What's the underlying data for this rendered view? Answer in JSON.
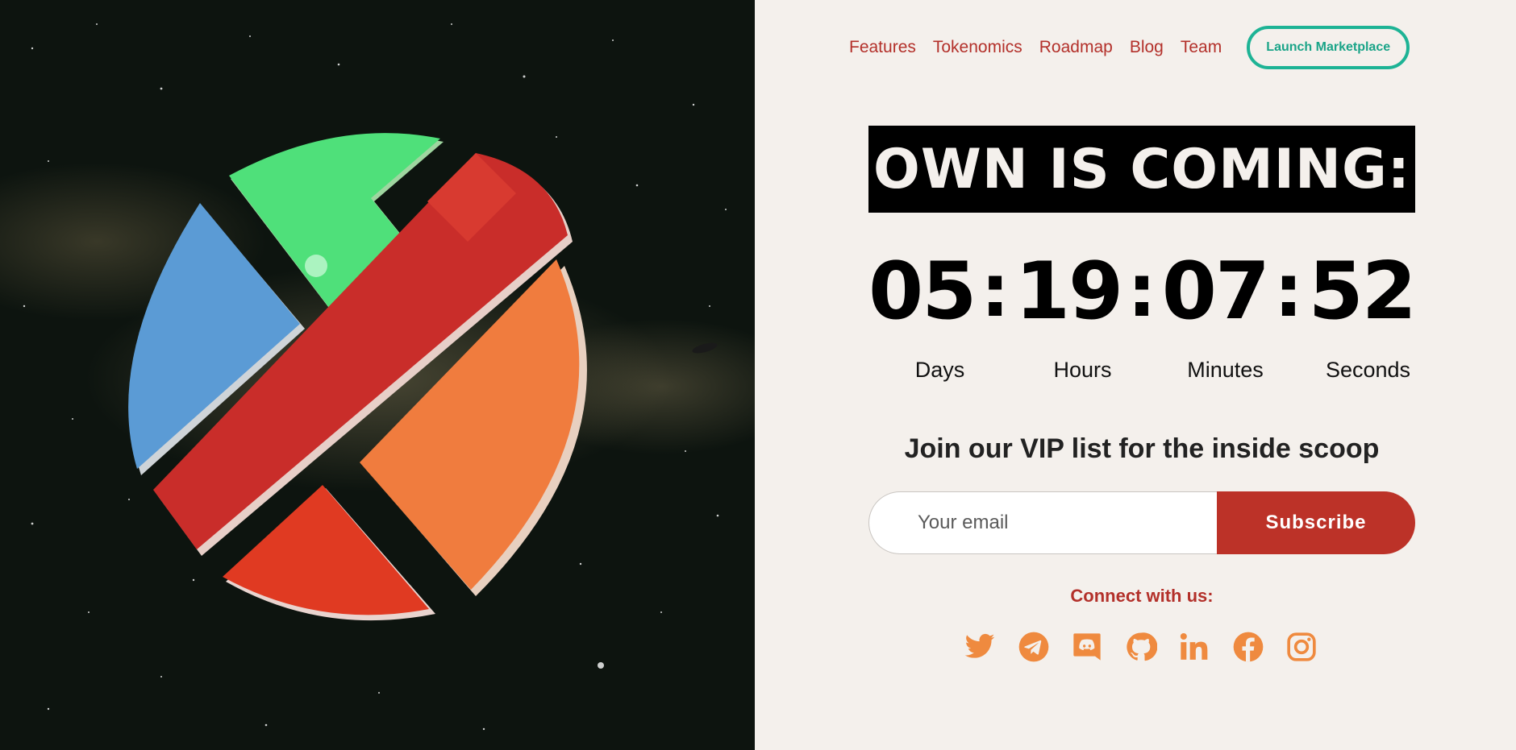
{
  "nav": {
    "links": [
      "Features",
      "Tokenomics",
      "Roadmap",
      "Blog",
      "Team"
    ],
    "launch_label": "Launch Marketplace"
  },
  "headline": "OWN IS COMING:",
  "countdown": {
    "days": "05",
    "hours": "19",
    "minutes": "07",
    "seconds": "52",
    "separator": ":",
    "labels": [
      "Days",
      "Hours",
      "Minutes",
      "Seconds"
    ]
  },
  "signup": {
    "title": "Join our VIP list for the inside scoop",
    "email_placeholder": "Your email",
    "subscribe_label": "Subscribe"
  },
  "connect_label": "Connect with us:",
  "socials": [
    "twitter-icon",
    "telegram-icon",
    "discord-icon",
    "github-icon",
    "linkedin-icon",
    "facebook-icon",
    "instagram-icon"
  ],
  "colors": {
    "accent_red": "#bc3228",
    "accent_teal": "#1db395",
    "social_orange": "#ef8a3f",
    "panel_bg": "#f4f0ec"
  }
}
